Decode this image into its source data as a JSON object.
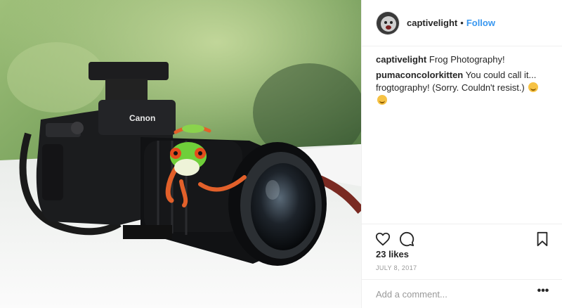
{
  "post": {
    "username": "captivelight",
    "separator": "•",
    "follow_label": "Follow",
    "caption": {
      "user": "captivelight",
      "text": "Frog Photography!"
    },
    "comments": [
      {
        "user": "pumaconcolorkitten",
        "text": "You could call it... frogtography! (Sorry. Couldn't resist.)"
      }
    ],
    "likes": "23 likes",
    "date": "JULY 8, 2017",
    "add_comment_placeholder": "Add a comment...",
    "more_icon": "ellipsis-icon"
  },
  "photo": {
    "brand_text": "Canon",
    "subject": "frog-on-camera-photo"
  },
  "colors": {
    "link": "#3897f0",
    "text": "#262626",
    "muted": "#999999",
    "border": "#efefef"
  }
}
